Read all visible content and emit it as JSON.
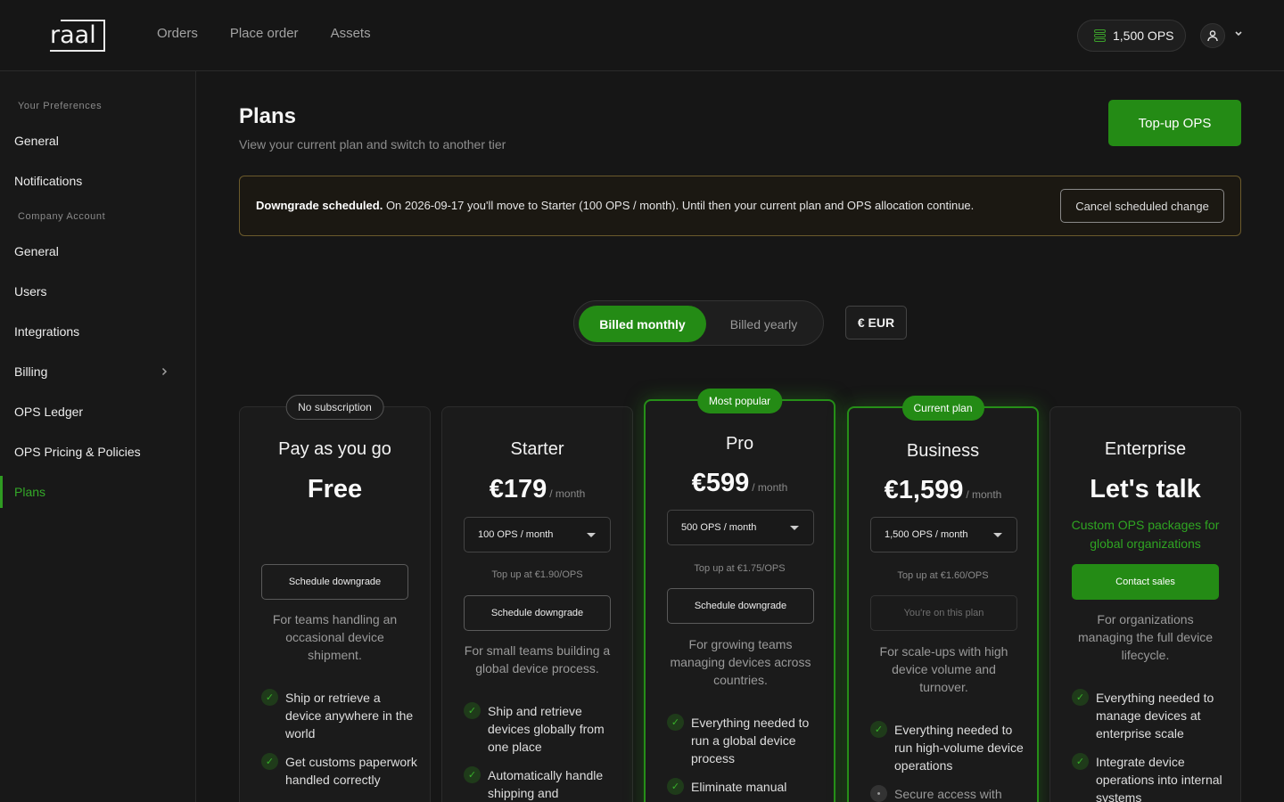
{
  "header": {
    "logo": "raal",
    "nav": [
      "Orders",
      "Place order",
      "Assets"
    ],
    "ops_balance": "1,500 OPS"
  },
  "sidebar": {
    "sections": [
      {
        "title": "Your Preferences",
        "items": [
          "General",
          "Notifications"
        ]
      },
      {
        "title": "Company Account",
        "items": [
          "General",
          "Users",
          "Integrations",
          "Billing",
          "OPS Ledger",
          "OPS Pricing & Policies",
          "Plans"
        ]
      }
    ],
    "active": "Plans"
  },
  "main": {
    "title": "Plans",
    "subtitle": "View your current plan and switch to another tier",
    "topup_label": "Top-up OPS",
    "banner": {
      "bold": "Downgrade scheduled.",
      "text": "On 2026-09-17 you'll move to Starter (100 OPS / month). Until then your current plan and OPS allocation continue.",
      "cancel_label": "Cancel scheduled change"
    },
    "billing": {
      "monthly": "Billed monthly",
      "yearly": "Billed yearly",
      "selected": "monthly"
    },
    "currency": "€ EUR"
  },
  "plans": [
    {
      "badge": "No subscription",
      "name": "Pay as you go",
      "price": "Free",
      "action": "Schedule downgrade",
      "desc": "For teams handling an occasional device shipment.",
      "features": [
        "Ship or retrieve a device anywhere in the world",
        "Get customs paperwork handled correctly"
      ]
    },
    {
      "name": "Starter",
      "price": "€179",
      "per": "/ month",
      "ops_select": "100 OPS / month",
      "topup": "Top up at €1.90/OPS",
      "action": "Schedule downgrade",
      "desc": "For small teams building a global device process.",
      "features": [
        "Ship and retrieve devices globally from one place",
        "Automatically handle shipping and"
      ]
    },
    {
      "badge": "Most popular",
      "name": "Pro",
      "price": "€599",
      "per": "/ month",
      "ops_select": "500 OPS / month",
      "topup": "Top up at €1.75/OPS",
      "action": "Schedule downgrade",
      "desc": "For growing teams managing devices across countries.",
      "features": [
        "Everything needed to run a global device process",
        "Eliminate manual"
      ]
    },
    {
      "badge": "Current plan",
      "name": "Business",
      "price": "€1,599",
      "per": "/ month",
      "ops_select": "1,500 OPS / month",
      "topup": "Top up at €1.60/OPS",
      "action": "You're on this plan",
      "desc": "For scale-ups with high device volume and turnover.",
      "features": [
        "Everything needed to run high-volume device operations",
        "Secure access with"
      ]
    },
    {
      "name": "Enterprise",
      "price": "Let's talk",
      "custom": "Custom OPS packages for global organizations",
      "action": "Contact sales",
      "desc": "For organizations managing the full device lifecycle.",
      "features": [
        "Everything needed to manage devices at enterprise scale",
        "Integrate device operations into internal systems"
      ]
    }
  ]
}
